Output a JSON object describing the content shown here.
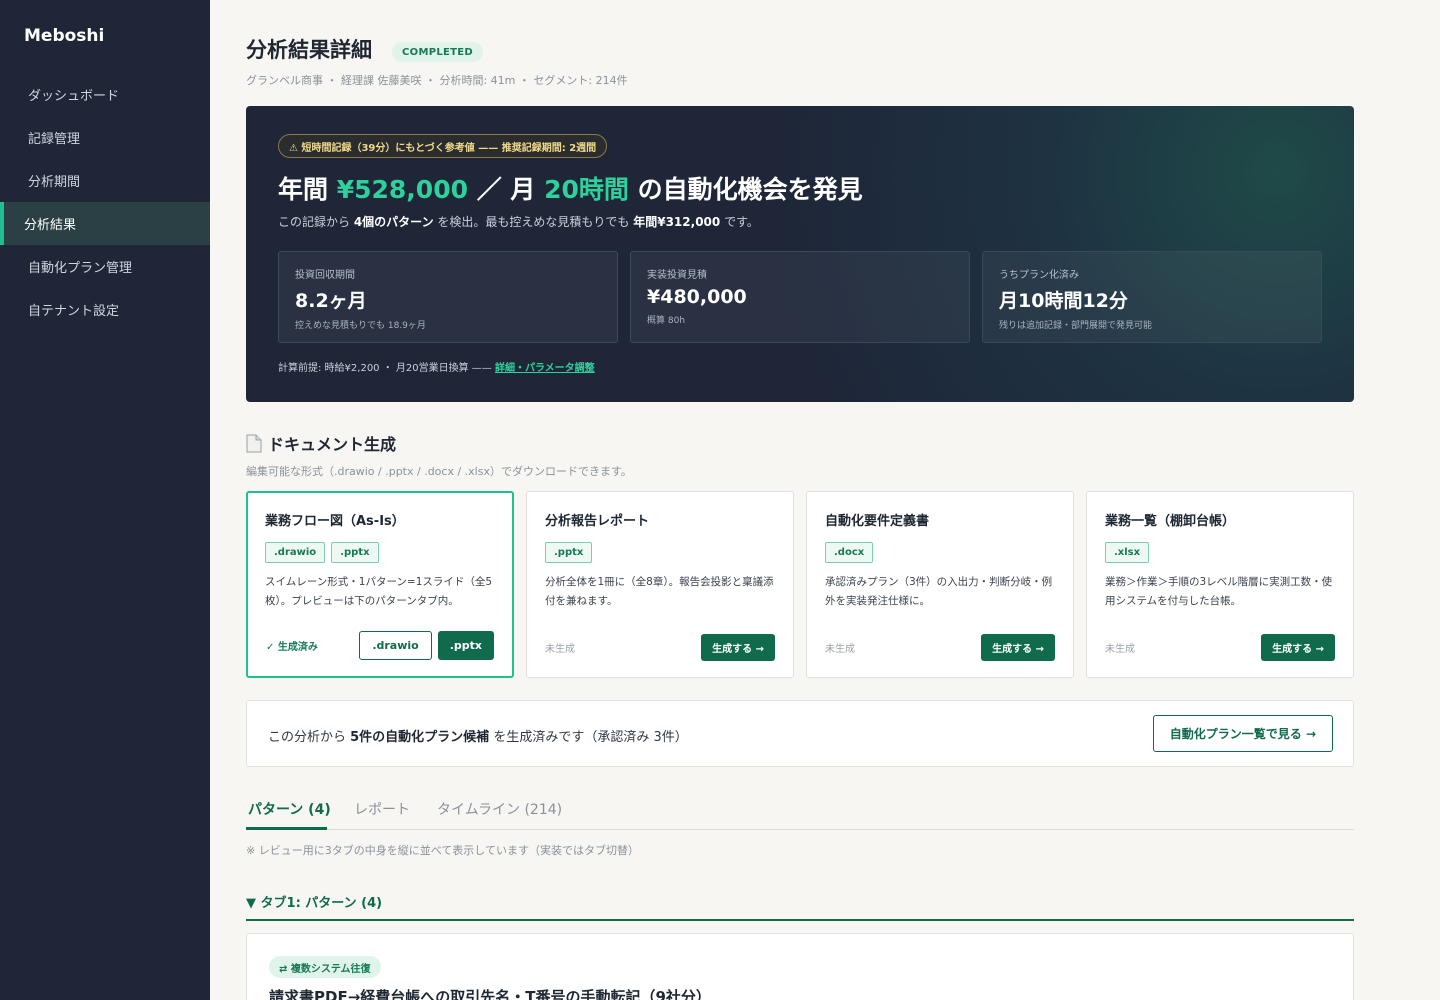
{
  "brand": "Meboshi",
  "nav": [
    {
      "label": "ダッシュボード"
    },
    {
      "label": "記録管理"
    },
    {
      "label": "分析期間"
    },
    {
      "label": "分析結果"
    },
    {
      "label": "自動化プラン管理"
    },
    {
      "label": "自テナント設定"
    }
  ],
  "page": {
    "title": "分析結果詳細",
    "status": "COMPLETED",
    "meta": "グランベル商事 ・ 経理課 佐藤美咲 ・ 分析時間: 41m ・ セグメント: 214件"
  },
  "hero": {
    "warning": "⚠ 短時間記録（39分）にもとづく参考値 —— 推奨記録期間: 2週間",
    "headline_prefix": "年間 ",
    "headline_amount": "¥528,000",
    "headline_sep": " ／ 月 ",
    "headline_hours": "20時間",
    "headline_suffix": " の自動化機会を発見",
    "sub_prefix": "この記録から ",
    "sub_patterns": "4個のパターン",
    "sub_mid": " を検出。最も控えめな見積もりでも ",
    "sub_amount": "年間¥312,000",
    "sub_suffix": " です。",
    "stats": [
      {
        "label": "投資回収期間",
        "value": "8.2ヶ月",
        "note": "控えめな見積もりでも 18.9ヶ月"
      },
      {
        "label": "実装投資見積",
        "value": "¥480,000",
        "note": "概算 80h"
      },
      {
        "label": "うちプラン化済み",
        "value": "月10時間12分",
        "note": "残りは追加記録・部門展開で発見可能"
      }
    ],
    "assumption": "計算前提: 時給¥2,200 ・ 月20営業日換算 —— ",
    "assumption_link": "詳細・パラメータ調整"
  },
  "documents": {
    "title": "ドキュメント生成",
    "description": "編集可能な形式（.drawio / .pptx / .docx / .xlsx）でダウンロードできます。",
    "cards": [
      {
        "title": "業務フロー図（As-Is）",
        "tags": [
          ".drawio",
          ".pptx"
        ],
        "desc": "スイムレーン形式・1パターン=1スライド（全5枚）。プレビューは下のパターンタブ内。",
        "status": "✓ 生成済み",
        "buttons": [
          ".drawio",
          ".pptx"
        ]
      },
      {
        "title": "分析報告レポート",
        "tags": [
          ".pptx"
        ],
        "desc": "分析全体を1冊に（全8章）。報告会投影と稟議添付を兼ねます。",
        "status": "未生成",
        "button": "生成する →"
      },
      {
        "title": "自動化要件定義書",
        "tags": [
          ".docx"
        ],
        "desc": "承認済みプラン（3件）の入出力・判断分岐・例外を実装発注仕様に。",
        "status": "未生成",
        "button": "生成する →"
      },
      {
        "title": "業務一覧（棚卸台帳）",
        "tags": [
          ".xlsx"
        ],
        "desc": "業務＞作業＞手順の3レベル階層に実測工数・使用システムを付与した台帳。",
        "status": "未生成",
        "button": "生成する →"
      }
    ]
  },
  "plans": {
    "text_prefix": "この分析から ",
    "text_bold": "5件の自動化プラン候補",
    "text_suffix": " を生成済みです（承認済み 3件）",
    "button": "自動化プラン一覧で見る →"
  },
  "tabs": [
    {
      "label": "パターン (4)"
    },
    {
      "label": "レポート"
    },
    {
      "label": "タイムライン (214)"
    }
  ],
  "review_note": "※ レビュー用に3タブの中身を縦に並べて表示しています（実装ではタブ切替）",
  "tab_section": "▼ タブ1: パターン (4)",
  "pattern": {
    "badge": "⇄ 複数システム往復",
    "title": "請求書PDF→経費台帳への取引先名・T番号の手動転記（9社分）"
  },
  "icons": {
    "document": "document-icon",
    "warning": "warning-icon"
  },
  "colors": {
    "accent": "#2fd19b",
    "primary": "#0f6b4c",
    "sidebar": "#1e2638"
  }
}
